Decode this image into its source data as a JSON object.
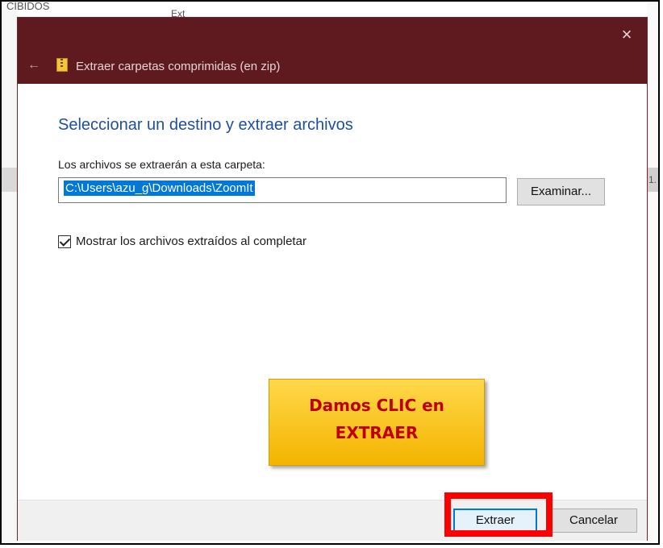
{
  "background": {
    "top_left_text": "CIBIDOS",
    "top_middle_text": "Ext",
    "right_edge_text": "1."
  },
  "dialog": {
    "title": "Extraer carpetas comprimidas (en zip)",
    "close_label": "×",
    "back_label": "←",
    "heading": "Seleccionar un destino y extraer archivos",
    "path_label": "Los archivos se extraerán a esta carpeta:",
    "path_value": "C:\\Users\\azu_g\\Downloads\\ZoomIt",
    "browse_label": "Examinar...",
    "show_files_label": "Mostrar los archivos extraídos al completar",
    "show_files_checked": true,
    "extract_label": "Extraer",
    "cancel_label": "Cancelar"
  },
  "annotation": {
    "callout_line1": "Damos CLIC en",
    "callout_line2": "EXTRAER",
    "highlight_color": "#ff0000",
    "callout_color": "#f4b400"
  },
  "colors": {
    "titlebar": "#5e1a1f",
    "heading": "#1f4e9e",
    "selection": "#0078d7"
  }
}
